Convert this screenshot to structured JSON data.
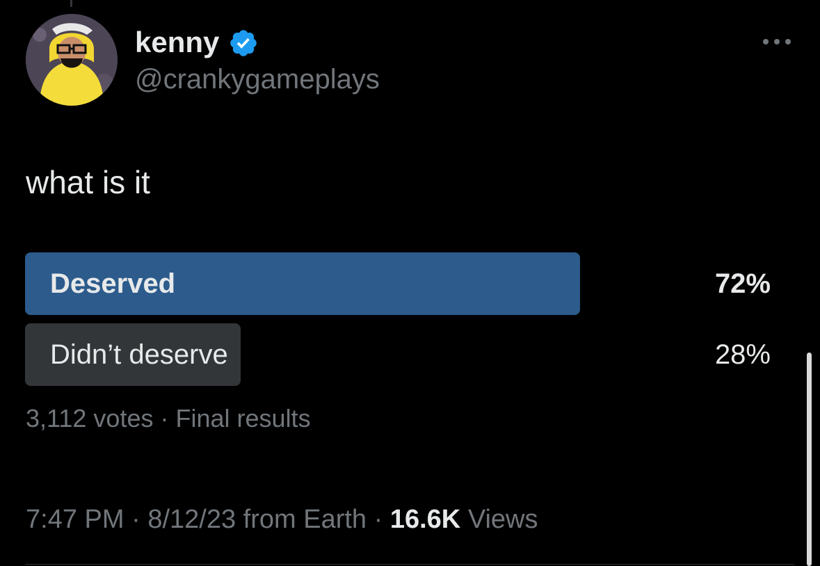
{
  "tweet": {
    "author": {
      "display_name": "kenny",
      "handle": "@crankygameplays",
      "verified": true,
      "avatar_icon": "avatar-image"
    },
    "text": "what is it",
    "more_icon": "more-horizontal-icon",
    "poll": {
      "options": [
        {
          "label": "Deserved",
          "percent": "72%",
          "fraction": 0.72,
          "winner": true
        },
        {
          "label": "Didn’t deserve",
          "percent": "28%",
          "fraction": 0.28,
          "winner": false
        }
      ],
      "votes": "3,112 votes",
      "separator": "·",
      "status": "Final results"
    },
    "meta": {
      "time": "7:47 PM",
      "date": "8/12/23",
      "source": "from Earth",
      "views_count": "16.6K",
      "views_label": "Views",
      "separator": "·"
    }
  },
  "colors": {
    "background": "#000000",
    "primary_text": "#e7e9ea",
    "secondary_text": "#71767b",
    "winner_bar": "#2c5b8c",
    "loser_bar": "#333639",
    "verified_badge": "#1d9bf0"
  }
}
